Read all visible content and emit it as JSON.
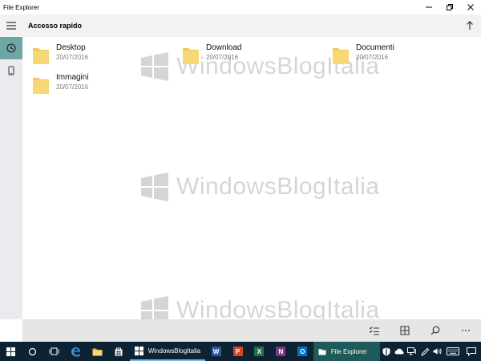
{
  "window": {
    "title": "File Explorer"
  },
  "header": {
    "location": "Accesso rapido"
  },
  "folders": [
    {
      "name": "Desktop",
      "date": "20/07/2016"
    },
    {
      "name": "Download",
      "date": "20/07/2016"
    },
    {
      "name": "Documenti",
      "date": "20/07/2016"
    },
    {
      "name": "Immagini",
      "date": "20/07/2016"
    }
  ],
  "watermark": {
    "text": "WindowsBlogItalia"
  },
  "taskbar": {
    "apps": [
      {
        "label": "WindowsBlogItalia"
      },
      {
        "label": "File Explorer"
      }
    ],
    "office": {
      "word": "W",
      "powerpoint": "P",
      "excel": "X",
      "onenote": "N",
      "outlook": "O"
    }
  },
  "colors": {
    "accent": "#6fa5a3",
    "folder": "#f8d775",
    "taskbar": "#0d2232",
    "header": "#f2f2f2",
    "commandbar": "#e6e6e6"
  }
}
